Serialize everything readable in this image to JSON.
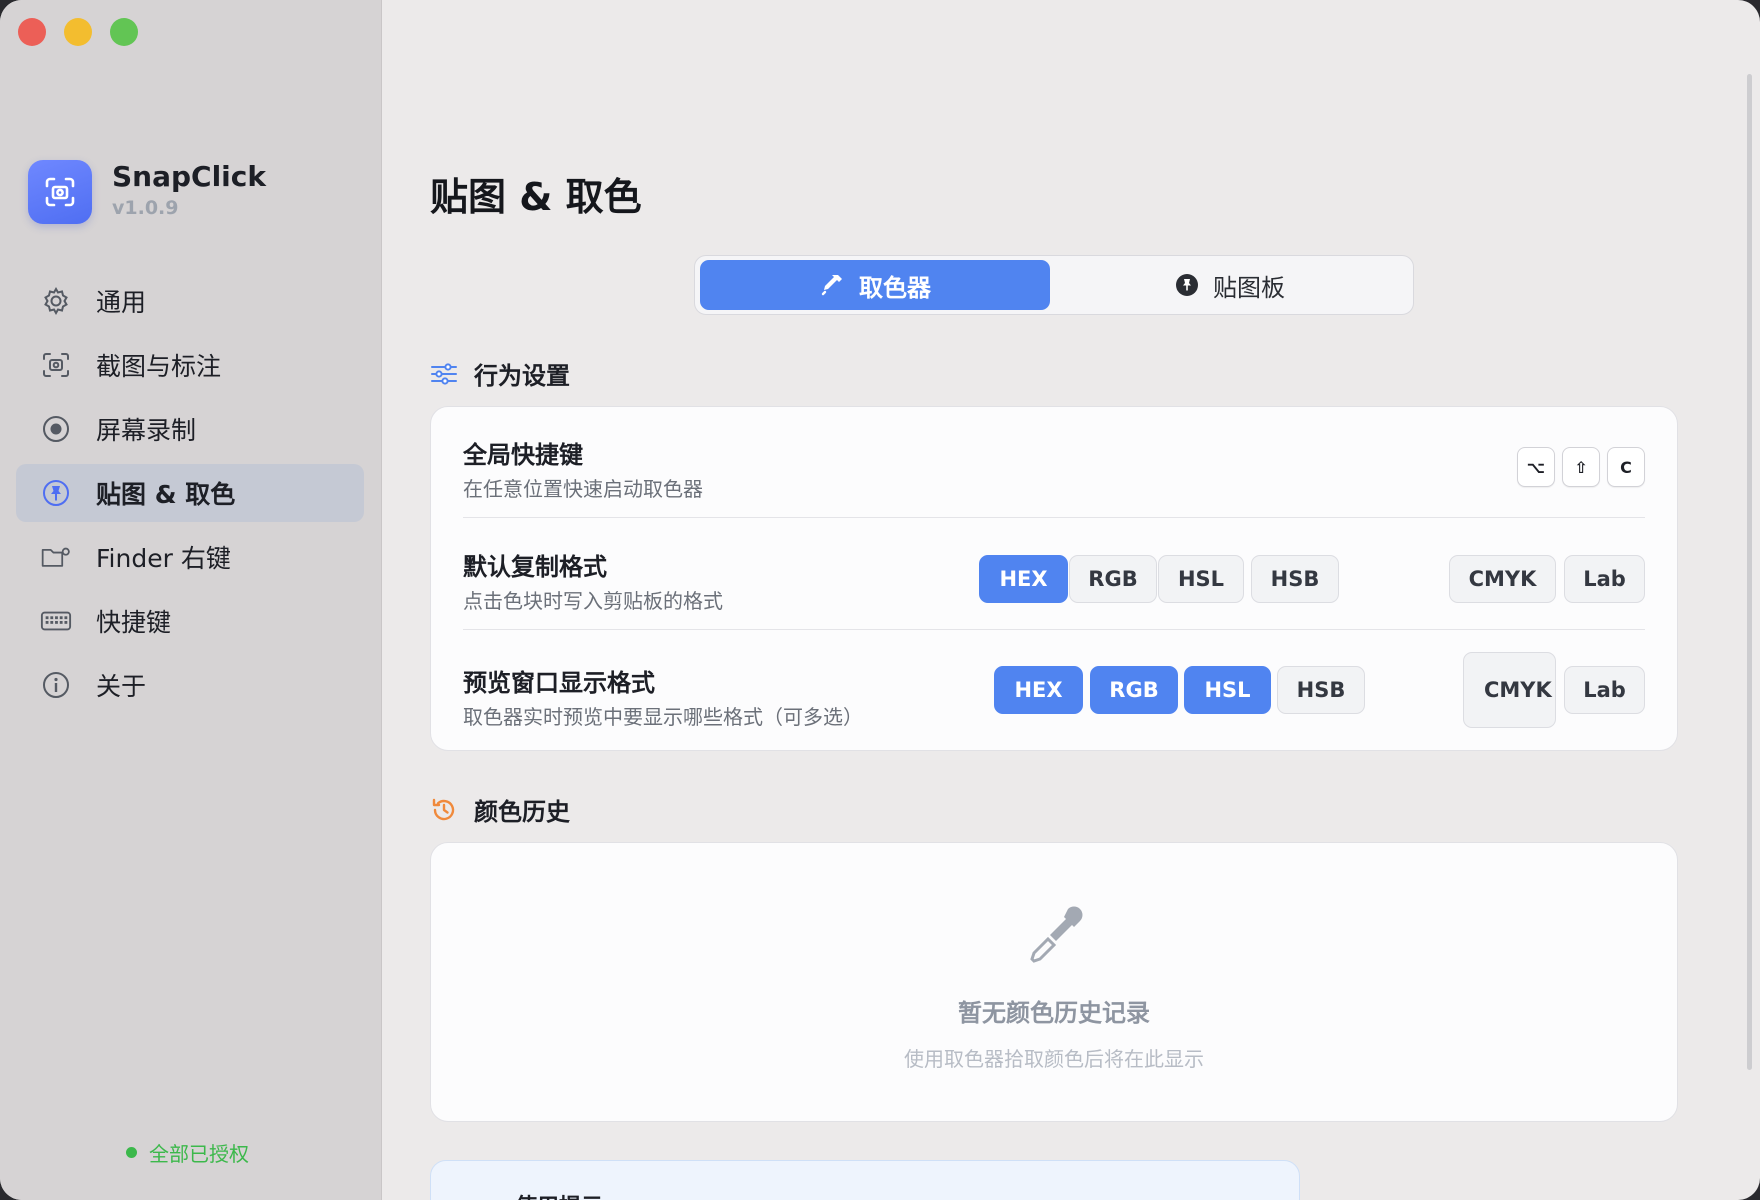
{
  "app": {
    "name": "SnapClick",
    "version": "v1.0.9"
  },
  "sidebar": {
    "items": [
      {
        "label": "通用",
        "icon": "gear-icon",
        "active": false
      },
      {
        "label": "截图与标注",
        "icon": "screenshot-icon",
        "active": false
      },
      {
        "label": "屏幕录制",
        "icon": "record-icon",
        "active": false
      },
      {
        "label": "贴图 & 取色",
        "icon": "pin-icon",
        "active": true
      },
      {
        "label": "Finder 右键",
        "icon": "finder-folder-icon",
        "active": false
      },
      {
        "label": "快捷键",
        "icon": "keyboard-icon",
        "active": false
      },
      {
        "label": "关于",
        "icon": "info-icon",
        "active": false
      }
    ],
    "auth_status": "全部已授权"
  },
  "main": {
    "title": "贴图 & 取色",
    "tabs": [
      {
        "label": "取色器",
        "icon": "eyedropper-icon",
        "selected": true
      },
      {
        "label": "贴图板",
        "icon": "pin-icon",
        "selected": false
      }
    ],
    "behavior_section": {
      "title": "行为设置",
      "icon": "sliders-icon",
      "rows": [
        {
          "title": "全局快捷键",
          "desc": "在任意位置快速启动取色器",
          "keys": [
            "⌥",
            "⇧",
            "C"
          ]
        },
        {
          "title": "默认复制格式",
          "desc": "点击色块时写入剪贴板的格式",
          "formats": [
            {
              "label": "HEX",
              "on": true
            },
            {
              "label": "RGB",
              "on": false
            },
            {
              "label": "HSL",
              "on": false
            },
            {
              "label": "HSB",
              "on": false
            },
            {
              "label": "CMYK",
              "on": false
            },
            {
              "label": "Lab",
              "on": false
            }
          ]
        },
        {
          "title": "预览窗口显示格式",
          "desc": "取色器实时预览中要显示哪些格式（可多选）",
          "formats": [
            {
              "label": "HEX",
              "on": true
            },
            {
              "label": "RGB",
              "on": true
            },
            {
              "label": "HSL",
              "on": true
            },
            {
              "label": "HSB",
              "on": false
            },
            {
              "label": "CMYK",
              "on": false
            },
            {
              "label": "Lab",
              "on": false
            }
          ]
        }
      ]
    },
    "history_section": {
      "title": "颜色历史",
      "icon": "history-icon",
      "empty_title": "暂无颜色历史记录",
      "empty_desc": "使用取色器拾取颜色后将在此显示"
    },
    "tips_section": {
      "title": "使用提示"
    }
  },
  "colors": {
    "accent": "#5084f0",
    "history_icon": "#f08a3c",
    "auth_green": "#3cb84b"
  }
}
